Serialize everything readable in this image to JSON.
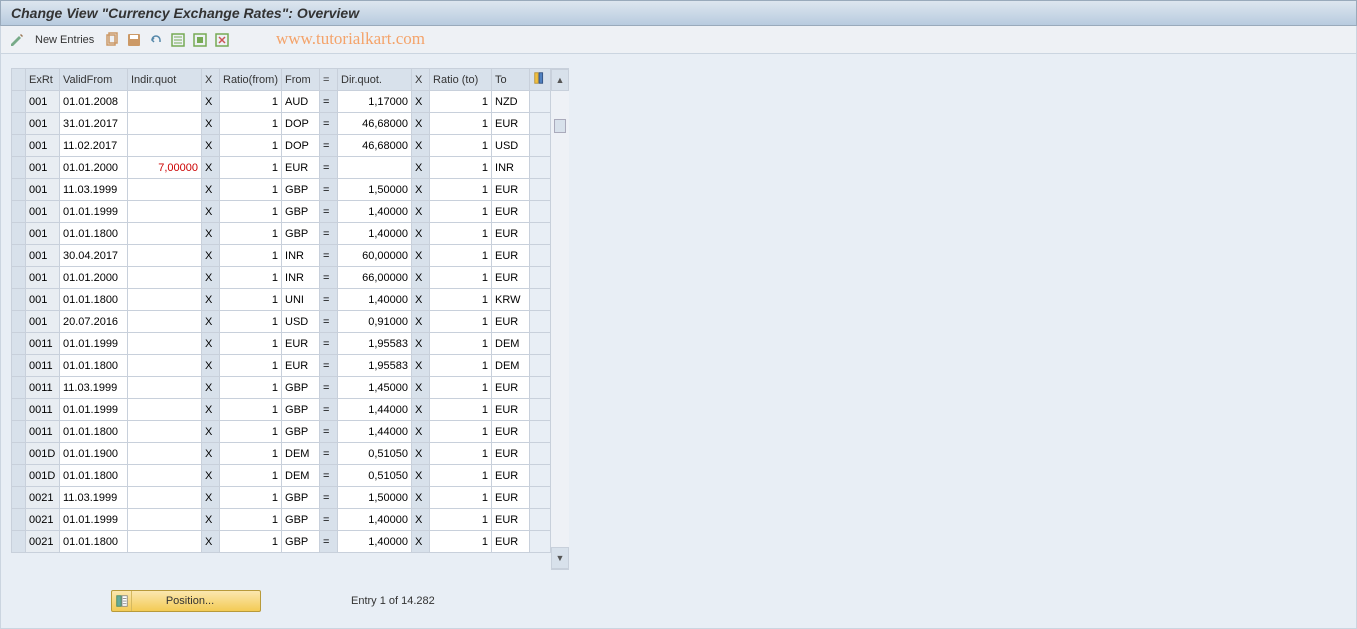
{
  "title": "Change View \"Currency Exchange Rates\": Overview",
  "toolbar": {
    "new_entries": "New Entries"
  },
  "watermark": "www.tutorialkart.com",
  "columns": {
    "exrt": "ExRt",
    "valid": "ValidFrom",
    "indir": "Indir.quot",
    "x1": "X",
    "ratio_f": "Ratio(from)",
    "from": "From",
    "eq": "=",
    "dir": "Dir.quot.",
    "x2": "X",
    "ratio_t": "Ratio (to)",
    "to": "To"
  },
  "rows": [
    {
      "exrt": "001",
      "valid": "01.01.2008",
      "indir": "",
      "x1": "X",
      "ratio_f": "1",
      "from": "AUD",
      "eq": "=",
      "dir": "1,17000",
      "x2": "X",
      "ratio_t": "1",
      "to": "NZD"
    },
    {
      "exrt": "001",
      "valid": "31.01.2017",
      "indir": "",
      "x1": "X",
      "ratio_f": "1",
      "from": "DOP",
      "eq": "=",
      "dir": "46,68000",
      "x2": "X",
      "ratio_t": "1",
      "to": "EUR"
    },
    {
      "exrt": "001",
      "valid": "11.02.2017",
      "indir": "",
      "x1": "X",
      "ratio_f": "1",
      "from": "DOP",
      "eq": "=",
      "dir": "46,68000",
      "x2": "X",
      "ratio_t": "1",
      "to": "USD"
    },
    {
      "exrt": "001",
      "valid": "01.01.2000",
      "indir": "7,00000",
      "indir_red": true,
      "x1": "X",
      "ratio_f": "1",
      "from": "EUR",
      "eq": "=",
      "dir": "",
      "x2": "X",
      "ratio_t": "1",
      "to": "INR"
    },
    {
      "exrt": "001",
      "valid": "11.03.1999",
      "indir": "",
      "x1": "X",
      "ratio_f": "1",
      "from": "GBP",
      "eq": "=",
      "dir": "1,50000",
      "x2": "X",
      "ratio_t": "1",
      "to": "EUR"
    },
    {
      "exrt": "001",
      "valid": "01.01.1999",
      "indir": "",
      "x1": "X",
      "ratio_f": "1",
      "from": "GBP",
      "eq": "=",
      "dir": "1,40000",
      "x2": "X",
      "ratio_t": "1",
      "to": "EUR"
    },
    {
      "exrt": "001",
      "valid": "01.01.1800",
      "indir": "",
      "x1": "X",
      "ratio_f": "1",
      "from": "GBP",
      "eq": "=",
      "dir": "1,40000",
      "x2": "X",
      "ratio_t": "1",
      "to": "EUR"
    },
    {
      "exrt": "001",
      "valid": "30.04.2017",
      "indir": "",
      "x1": "X",
      "ratio_f": "1",
      "from": "INR",
      "eq": "=",
      "dir": "60,00000",
      "x2": "X",
      "ratio_t": "1",
      "to": "EUR"
    },
    {
      "exrt": "001",
      "valid": "01.01.2000",
      "indir": "",
      "x1": "X",
      "ratio_f": "1",
      "from": "INR",
      "eq": "=",
      "dir": "66,00000",
      "x2": "X",
      "ratio_t": "1",
      "to": "EUR"
    },
    {
      "exrt": "001",
      "valid": "01.01.1800",
      "indir": "",
      "x1": "X",
      "ratio_f": "1",
      "from": "UNI",
      "eq": "=",
      "dir": "1,40000",
      "x2": "X",
      "ratio_t": "1",
      "to": "KRW"
    },
    {
      "exrt": "001",
      "valid": "20.07.2016",
      "indir": "",
      "x1": "X",
      "ratio_f": "1",
      "from": "USD",
      "eq": "=",
      "dir": "0,91000",
      "x2": "X",
      "ratio_t": "1",
      "to": "EUR"
    },
    {
      "exrt": "0011",
      "valid": "01.01.1999",
      "indir": "",
      "x1": "X",
      "ratio_f": "1",
      "from": "EUR",
      "eq": "=",
      "dir": "1,95583",
      "x2": "X",
      "ratio_t": "1",
      "to": "DEM"
    },
    {
      "exrt": "0011",
      "valid": "01.01.1800",
      "indir": "",
      "x1": "X",
      "ratio_f": "1",
      "from": "EUR",
      "eq": "=",
      "dir": "1,95583",
      "x2": "X",
      "ratio_t": "1",
      "to": "DEM"
    },
    {
      "exrt": "0011",
      "valid": "11.03.1999",
      "indir": "",
      "x1": "X",
      "ratio_f": "1",
      "from": "GBP",
      "eq": "=",
      "dir": "1,45000",
      "x2": "X",
      "ratio_t": "1",
      "to": "EUR"
    },
    {
      "exrt": "0011",
      "valid": "01.01.1999",
      "indir": "",
      "x1": "X",
      "ratio_f": "1",
      "from": "GBP",
      "eq": "=",
      "dir": "1,44000",
      "x2": "X",
      "ratio_t": "1",
      "to": "EUR"
    },
    {
      "exrt": "0011",
      "valid": "01.01.1800",
      "indir": "",
      "x1": "X",
      "ratio_f": "1",
      "from": "GBP",
      "eq": "=",
      "dir": "1,44000",
      "x2": "X",
      "ratio_t": "1",
      "to": "EUR"
    },
    {
      "exrt": "001D",
      "valid": "01.01.1900",
      "indir": "",
      "x1": "X",
      "ratio_f": "1",
      "from": "DEM",
      "eq": "=",
      "dir": "0,51050",
      "x2": "X",
      "ratio_t": "1",
      "to": "EUR"
    },
    {
      "exrt": "001D",
      "valid": "01.01.1800",
      "indir": "",
      "x1": "X",
      "ratio_f": "1",
      "from": "DEM",
      "eq": "=",
      "dir": "0,51050",
      "x2": "X",
      "ratio_t": "1",
      "to": "EUR"
    },
    {
      "exrt": "0021",
      "valid": "11.03.1999",
      "indir": "",
      "x1": "X",
      "ratio_f": "1",
      "from": "GBP",
      "eq": "=",
      "dir": "1,50000",
      "x2": "X",
      "ratio_t": "1",
      "to": "EUR"
    },
    {
      "exrt": "0021",
      "valid": "01.01.1999",
      "indir": "",
      "x1": "X",
      "ratio_f": "1",
      "from": "GBP",
      "eq": "=",
      "dir": "1,40000",
      "x2": "X",
      "ratio_t": "1",
      "to": "EUR"
    },
    {
      "exrt": "0021",
      "valid": "01.01.1800",
      "indir": "",
      "x1": "X",
      "ratio_f": "1",
      "from": "GBP",
      "eq": "=",
      "dir": "1,40000",
      "x2": "X",
      "ratio_t": "1",
      "to": "EUR"
    }
  ],
  "position_btn": "Position...",
  "entry_text": "Entry 1 of 14.282"
}
